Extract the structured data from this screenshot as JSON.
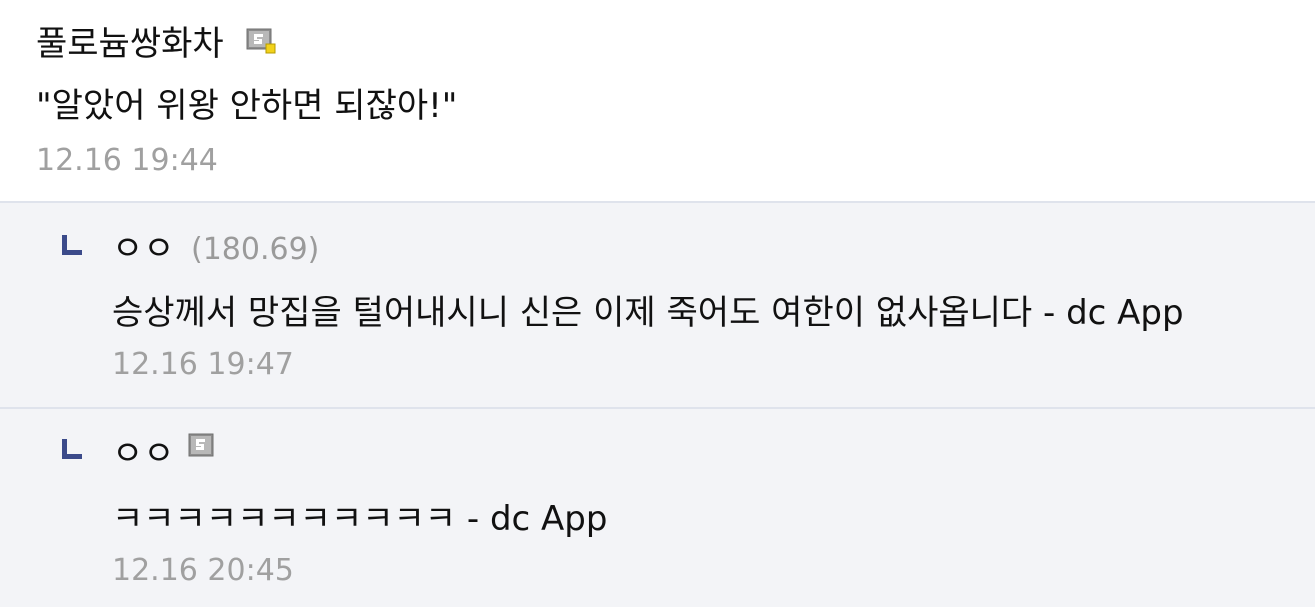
{
  "comments": [
    {
      "nickname": "풀로늄쌍화차",
      "has_gallog_icon": true,
      "text": "\"알았어 위왕 안하면 되잖아!\"",
      "time": "12.16 19:44"
    },
    {
      "nickname": "ㅇㅇ",
      "ip": "(180.69)",
      "text": "승상께서 망집을 털어내시니 신은 이제 죽어도 여한이 없사옵니다 - dc App",
      "time": "12.16 19:47"
    },
    {
      "nickname": "ㅇㅇ",
      "has_gallog_icon": true,
      "text": "ㅋㅋㅋㅋㅋㅋㅋㅋㅋㅋㅋ - dc App",
      "time": "12.16 20:45"
    }
  ],
  "colors": {
    "reply_arrow": "#3b4a8a",
    "reply_bg": "#f3f4f7",
    "divider": "#dfe3ec",
    "timestamp": "#a0a0a0"
  }
}
